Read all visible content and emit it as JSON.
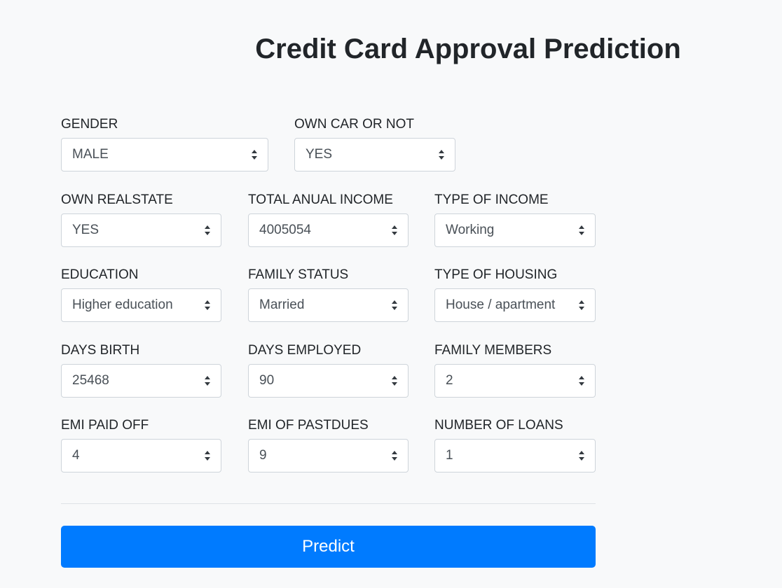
{
  "header": {
    "title": "Credit Card Approval Prediction"
  },
  "form": {
    "gender": {
      "label": "GENDER",
      "value": "MALE"
    },
    "own_car": {
      "label": "OWN CAR OR NOT",
      "value": "YES"
    },
    "own_realstate": {
      "label": "OWN REALSTATE",
      "value": "YES"
    },
    "total_income": {
      "label": "TOTAL ANUAL INCOME",
      "value": "4005054"
    },
    "income_type": {
      "label": "TYPE OF INCOME",
      "value": "Working"
    },
    "education": {
      "label": "EDUCATION",
      "value": "Higher education"
    },
    "family_status": {
      "label": "FAMILY STATUS",
      "value": "Married"
    },
    "housing_type": {
      "label": "TYPE OF HOUSING",
      "value": "House / apartment"
    },
    "days_birth": {
      "label": "DAYS BIRTH",
      "value": "25468"
    },
    "days_employed": {
      "label": "DAYS EMPLOYED",
      "value": "90"
    },
    "family_members": {
      "label": "FAMILY MEMBERS",
      "value": "2"
    },
    "emi_paid_off": {
      "label": "EMI PAID OFF",
      "value": "4"
    },
    "emi_pastdues": {
      "label": "EMI OF PASTDUES",
      "value": "9"
    },
    "number_of_loans": {
      "label": "NUMBER OF LOANS",
      "value": "1"
    }
  },
  "actions": {
    "predict_label": "Predict"
  },
  "colors": {
    "background": "#f8f9fa",
    "primary": "#007bff",
    "text": "#212529",
    "input_text": "#495057",
    "input_border": "#ced4da"
  },
  "icons": {
    "select_caret": "sort-caret-icon"
  }
}
